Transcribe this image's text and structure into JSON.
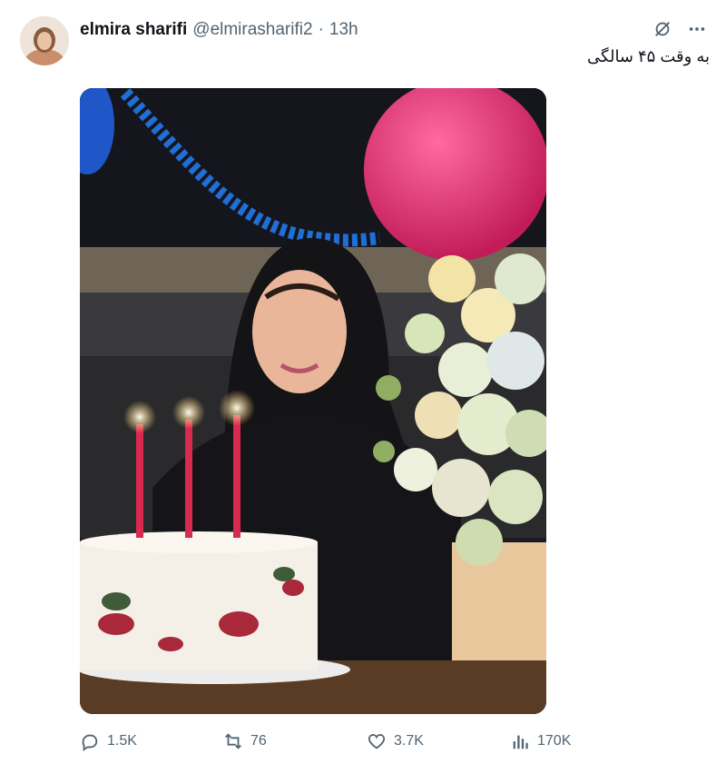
{
  "tweet": {
    "author_name": "elmira sharifi",
    "handle": "@elmirasharifi2",
    "separator": "·",
    "time": "13h",
    "text": "به وقت ۴۵ سالگی"
  },
  "stats": {
    "replies": "1.5K",
    "retweets": "76",
    "likes": "3.7K",
    "views": "170K"
  },
  "icons": {
    "grok": "grok-icon",
    "more": "more-icon",
    "reply": "reply-icon",
    "retweet": "retweet-icon",
    "like": "heart-icon",
    "views": "views-icon"
  },
  "colors": {
    "text_primary": "#0f1419",
    "text_secondary": "#536471",
    "balloon_pink": "#e0296a",
    "balloon_blue": "#1f57c9"
  }
}
